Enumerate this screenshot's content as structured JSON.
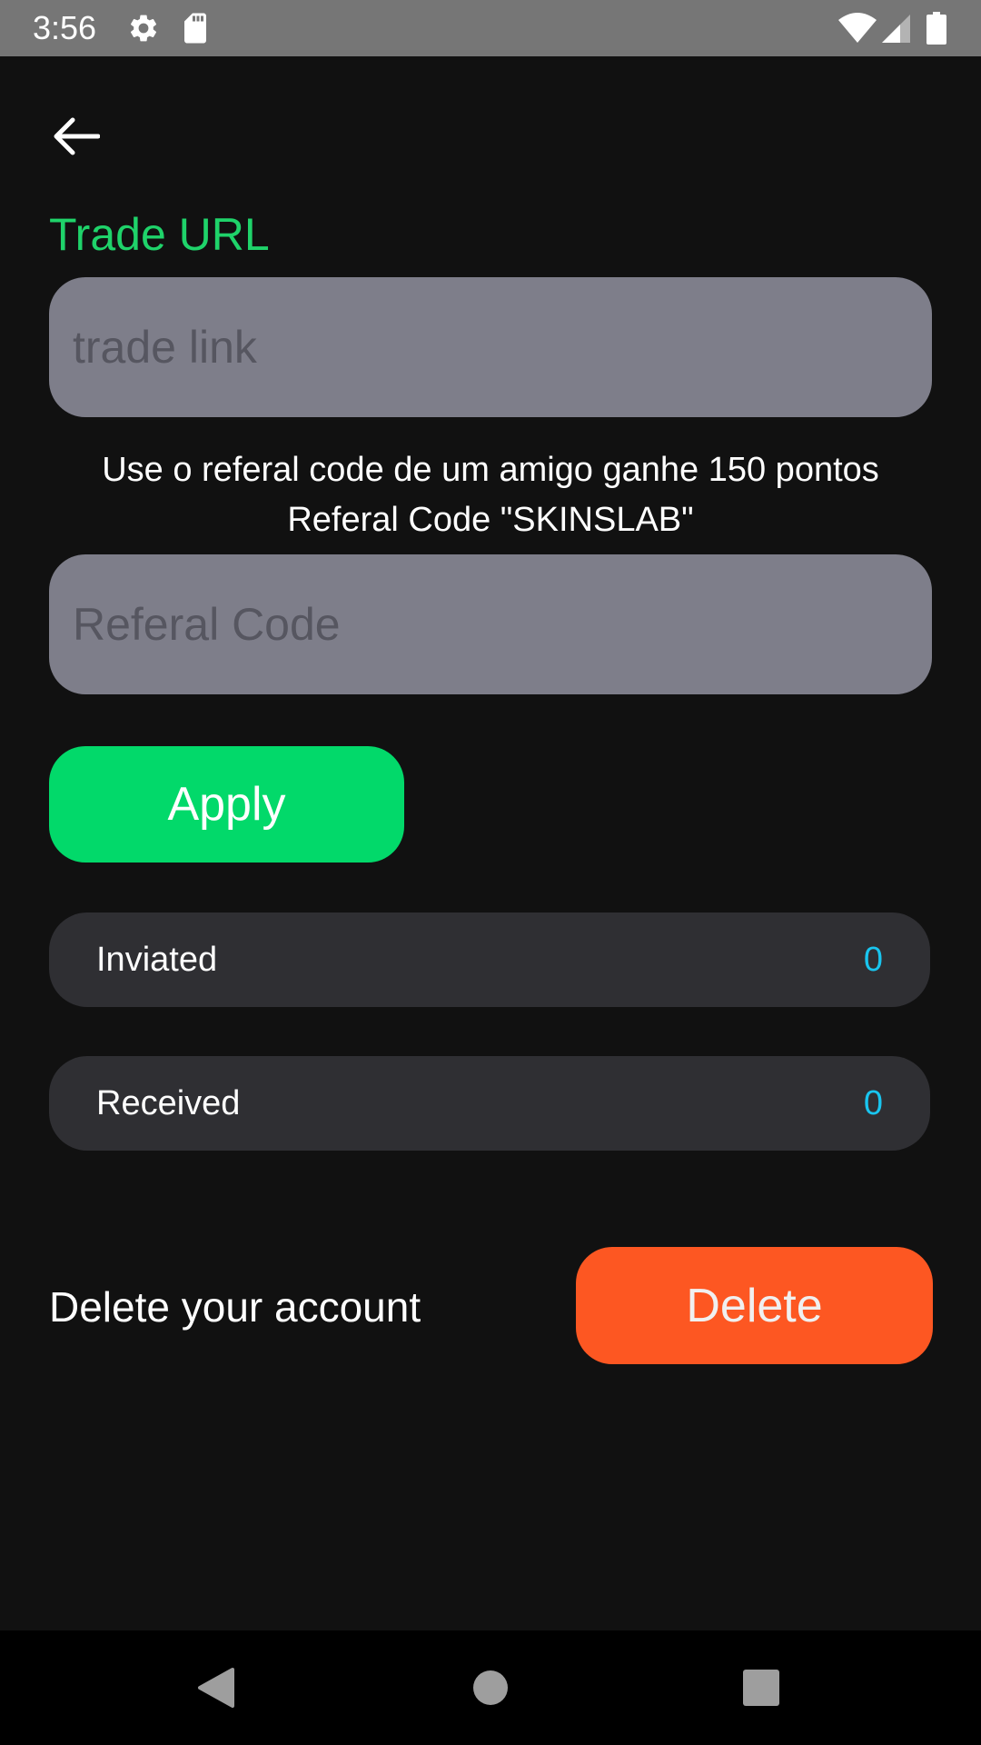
{
  "status_bar": {
    "time": "3:56",
    "left_icons": [
      "gear-icon",
      "sd-card-icon"
    ],
    "right_icons": [
      "wifi-icon",
      "cellular-signal-icon",
      "battery-icon"
    ]
  },
  "header": {
    "back_icon": "arrow-left-icon"
  },
  "trade_url": {
    "title": "Trade URL",
    "value": "",
    "placeholder": "trade link"
  },
  "referral": {
    "info_line1": "Use o referal code de um amigo ganhe 150 pontos",
    "info_line2": "Referal Code \"SKINSLAB\"",
    "value": "",
    "placeholder": "Referal Code",
    "apply_label": "Apply"
  },
  "stats": [
    {
      "label": "Inviated",
      "value": "0"
    },
    {
      "label": "Received",
      "value": "0"
    }
  ],
  "account": {
    "delete_text": "Delete your account",
    "delete_label": "Delete"
  },
  "nav_bar": {
    "icons": [
      "back-triangle-icon",
      "home-circle-icon",
      "recents-square-icon"
    ]
  },
  "colors": {
    "background": "#111111",
    "accent_green": "#02d96a",
    "title_green": "#1fd36a",
    "stat_value_blue": "#19c5ef",
    "delete_orange": "#fd5722",
    "input_gray": "#7e7e8a",
    "stat_row_bg": "#2f2f33"
  }
}
